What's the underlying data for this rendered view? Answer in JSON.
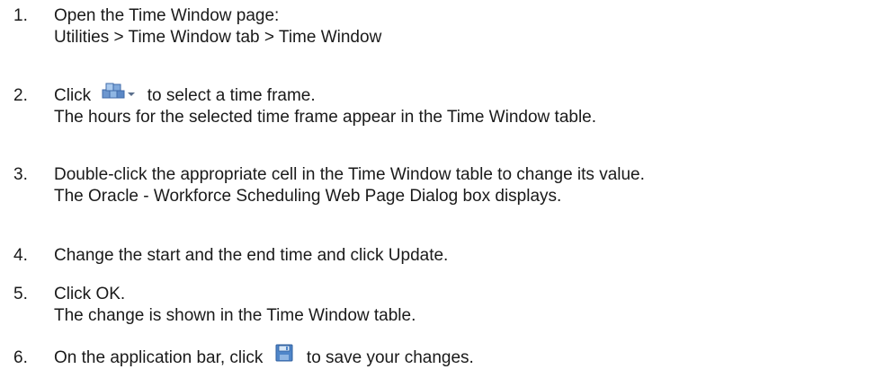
{
  "steps": [
    {
      "number": "1.",
      "lines": [
        "Open the Time Window page:",
        "Utilities > Time Window tab > Time Window"
      ]
    },
    {
      "number": "2.",
      "before_icon": "Click",
      "icon": "time-frame-selector-icon",
      "after_icon": "to select a time frame.",
      "line2": "The hours for the selected time frame appear in the Time Window table."
    },
    {
      "number": "3.",
      "lines": [
        "Double-click the appropriate cell in the Time Window table to change its value.",
        "The Oracle - Workforce Scheduling Web Page Dialog box displays."
      ]
    },
    {
      "number": "4.",
      "lines": [
        "Change the start and the end time and click Update."
      ]
    },
    {
      "number": "5.",
      "lines": [
        "Click OK.",
        "The change is shown in the Time Window table."
      ]
    },
    {
      "number": "6.",
      "before_icon": "On the application bar, click",
      "icon": "save-icon",
      "after_icon": "to save your changes."
    }
  ],
  "colors": {
    "text": "#1a1a1a",
    "icon_blue": "#4a7fc1",
    "icon_light": "#9cc3ea"
  }
}
